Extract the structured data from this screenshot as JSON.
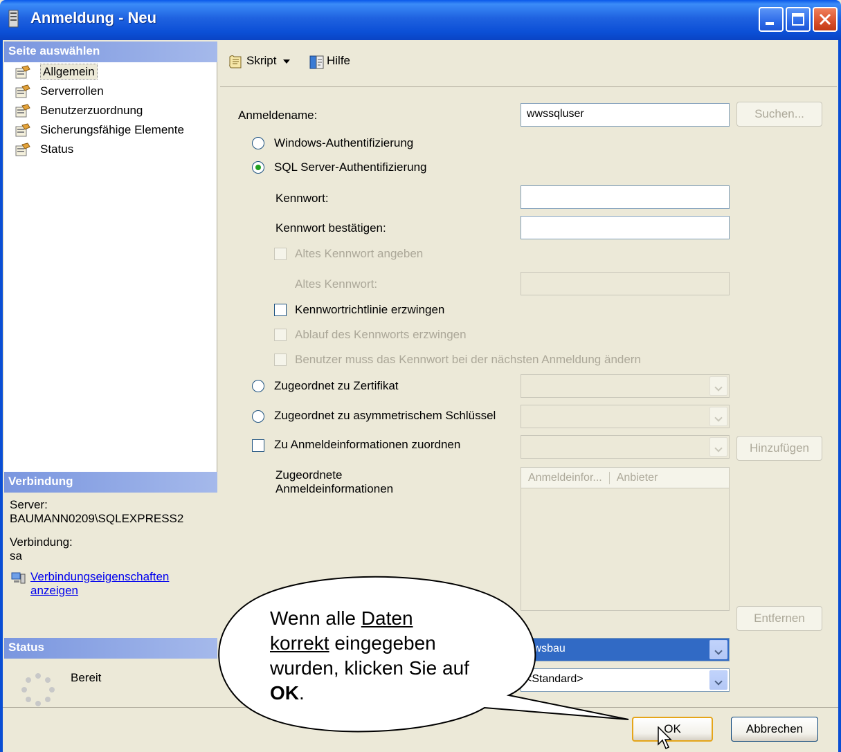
{
  "window": {
    "title": "Anmeldung - Neu"
  },
  "left": {
    "select_page_header": "Seite auswählen",
    "pages": [
      "Allgemein",
      "Serverrollen",
      "Benutzerzuordnung",
      "Sicherungsfähige Elemente",
      "Status"
    ],
    "connection_header": "Verbindung",
    "server_label": "Server:",
    "server_value": "BAUMANN0209\\SQLEXPRESS2",
    "connection_label": "Verbindung:",
    "connection_value": "sa",
    "connection_link_line1": "Verbindungseigenschaften",
    "connection_link_line2": "anzeigen",
    "status_header": "Status",
    "status_value": "Bereit"
  },
  "toolbar": {
    "script_label": "Skript",
    "help_label": "Hilfe"
  },
  "form": {
    "login_name_label": "Anmeldename:",
    "login_name_value": "wwssqluser",
    "search_button": "Suchen...",
    "windows_auth": "Windows-Authentifizierung",
    "sql_auth": "SQL Server-Authentifizierung",
    "password_label": "Kennwort:",
    "confirm_password_label": "Kennwort bestätigen:",
    "specify_old_password": "Altes Kennwort angeben",
    "old_password_label": "Altes Kennwort:",
    "enforce_policy": "Kennwortrichtlinie erzwingen",
    "enforce_expiration": "Ablauf des Kennworts erzwingen",
    "must_change": "Benutzer muss das Kennwort bei der nächsten Anmeldung ändern",
    "mapped_cert": "Zugeordnet zu Zertifikat",
    "mapped_asym_key": "Zugeordnet zu asymmetrischem Schlüssel",
    "map_credential": "Zu Anmeldeinformationen zuordnen",
    "add_button": "Hinzufügen",
    "mapped_credentials_line1": "Zugeordnete",
    "mapped_credentials_line2": "Anmeldeinformationen",
    "list_col1": "Anmeldeinfor...",
    "list_col2": "Anbieter",
    "remove_button": "Entfernen",
    "default_db_value": "wwsbau",
    "default_lang_value": "<Standard>"
  },
  "buttons": {
    "ok": "OK",
    "cancel": "Abbrechen"
  },
  "callout": {
    "part1": "Wenn alle ",
    "u1": "Daten",
    "u2": "korrekt",
    "part2": " eingegeben wurden, klicken Sie auf ",
    "bold": "OK",
    "part3": "."
  },
  "colors": {
    "title_bar": "#0A4ED4",
    "section_header": "#7A96DF",
    "selected_combo": "#316AC5",
    "link": "#0000EE"
  }
}
